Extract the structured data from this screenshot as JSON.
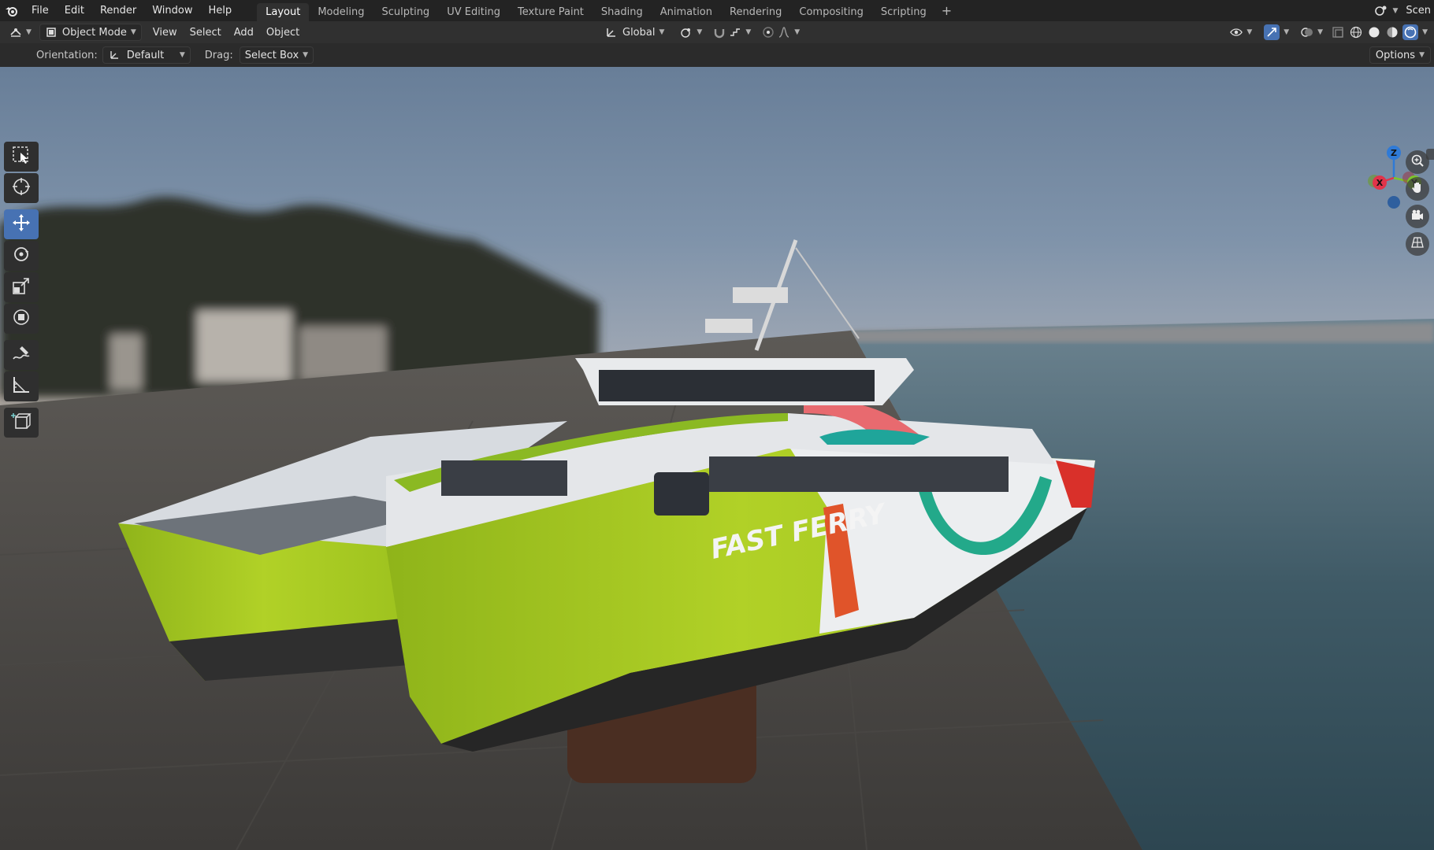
{
  "topbar": {
    "menus": [
      "File",
      "Edit",
      "Render",
      "Window",
      "Help"
    ],
    "workspaces": [
      {
        "label": "Layout",
        "active": true
      },
      {
        "label": "Modeling",
        "active": false
      },
      {
        "label": "Sculpting",
        "active": false
      },
      {
        "label": "UV Editing",
        "active": false
      },
      {
        "label": "Texture Paint",
        "active": false
      },
      {
        "label": "Shading",
        "active": false
      },
      {
        "label": "Animation",
        "active": false
      },
      {
        "label": "Rendering",
        "active": false
      },
      {
        "label": "Compositing",
        "active": false
      },
      {
        "label": "Scripting",
        "active": false
      }
    ],
    "scene_label": "Scen"
  },
  "header": {
    "mode": "Object Mode",
    "menus": [
      "View",
      "Select",
      "Add",
      "Object"
    ],
    "transform_orientation": "Global"
  },
  "toolsettings": {
    "orientation_label": "Orientation:",
    "orientation_value": "Default",
    "drag_label": "Drag:",
    "drag_value": "Select Box",
    "options_label": "Options"
  },
  "viewport": {
    "hull_text": "FAST FERRY",
    "gizmo": {
      "x": "X",
      "y": "Y",
      "z": "Z"
    }
  },
  "colors": {
    "accent": "#4772b3",
    "hull_green": "#a6c81e",
    "axis_x": "#e0344a",
    "axis_y": "#7bc62a",
    "axis_z": "#2f7ad6"
  }
}
